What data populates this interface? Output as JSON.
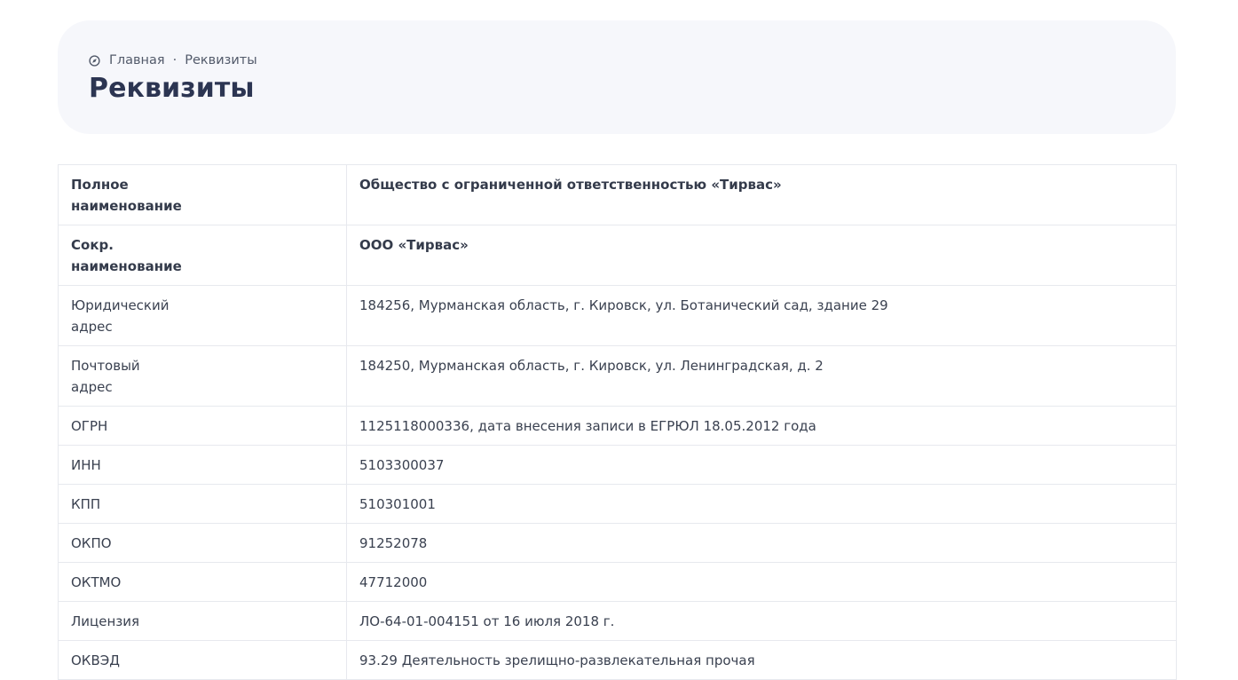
{
  "breadcrumb": {
    "home_icon": "compass-icon",
    "home": "Главная",
    "separator": "·",
    "current": "Реквизиты"
  },
  "page_title": "Реквизиты",
  "requisites": [
    {
      "label_lines": [
        "Полное",
        "наименование"
      ],
      "value": "Общество с ограниченной ответственностью «Тирвас»",
      "bold": true
    },
    {
      "label_lines": [
        "Сокр.",
        "наименование"
      ],
      "value": "ООО «Тирвас»",
      "bold": true
    },
    {
      "label_lines": [
        "Юридический",
        "адрес"
      ],
      "value": "184256, Мурманская область, г. Кировск, ул. Ботанический сад, здание 29",
      "bold": false
    },
    {
      "label_lines": [
        "Почтовый",
        "адрес"
      ],
      "value": "184250, Мурманская область, г. Кировск, ул. Ленинградская, д. 2",
      "bold": false
    },
    {
      "label": "ОГРН",
      "value": "1125118000336, дата внесения записи в ЕГРЮЛ 18.05.2012 года"
    },
    {
      "label": "ИНН",
      "value": "5103300037"
    },
    {
      "label": "КПП",
      "value": "510301001"
    },
    {
      "label": "ОКПО",
      "value": "91252078"
    },
    {
      "label": "ОКТМО",
      "value": "47712000"
    },
    {
      "label": "Лицензия",
      "value": "ЛО-64-01-004151 от 16 июля 2018 г."
    },
    {
      "label": "ОКВЭД",
      "value": "93.29 Деятельность зрелищно-развлекательная прочая"
    }
  ]
}
